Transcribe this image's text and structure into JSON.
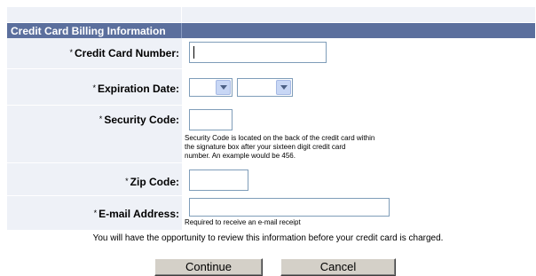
{
  "header": {
    "title": "Credit Card Billing Information"
  },
  "fields": {
    "card_number": {
      "required_mark": "*",
      "label": "Credit Card Number:",
      "value": ""
    },
    "expiration": {
      "required_mark": "*",
      "label": "Expiration  Date:",
      "month_value": "",
      "year_value": ""
    },
    "security_code": {
      "required_mark": "*",
      "label": "Security Code:",
      "value": "",
      "help_lines": [
        "Security Code is located on the back of the credit card within",
        "the signature box after your sixteen digit credit card",
        "number.  An example would be 456."
      ]
    },
    "zip": {
      "required_mark": "*",
      "label": "Zip Code:",
      "value": ""
    },
    "email": {
      "required_mark": "*",
      "label": "E-mail Address:",
      "value": "",
      "help": "Required to receive an e-mail receipt"
    }
  },
  "note": "You will have the opportunity to review this information before your credit card is charged.",
  "buttons": {
    "continue": "Continue",
    "cancel": "Cancel"
  },
  "colors": {
    "header_bg": "#5b6f9d",
    "label_bg": "#eef1f7"
  }
}
